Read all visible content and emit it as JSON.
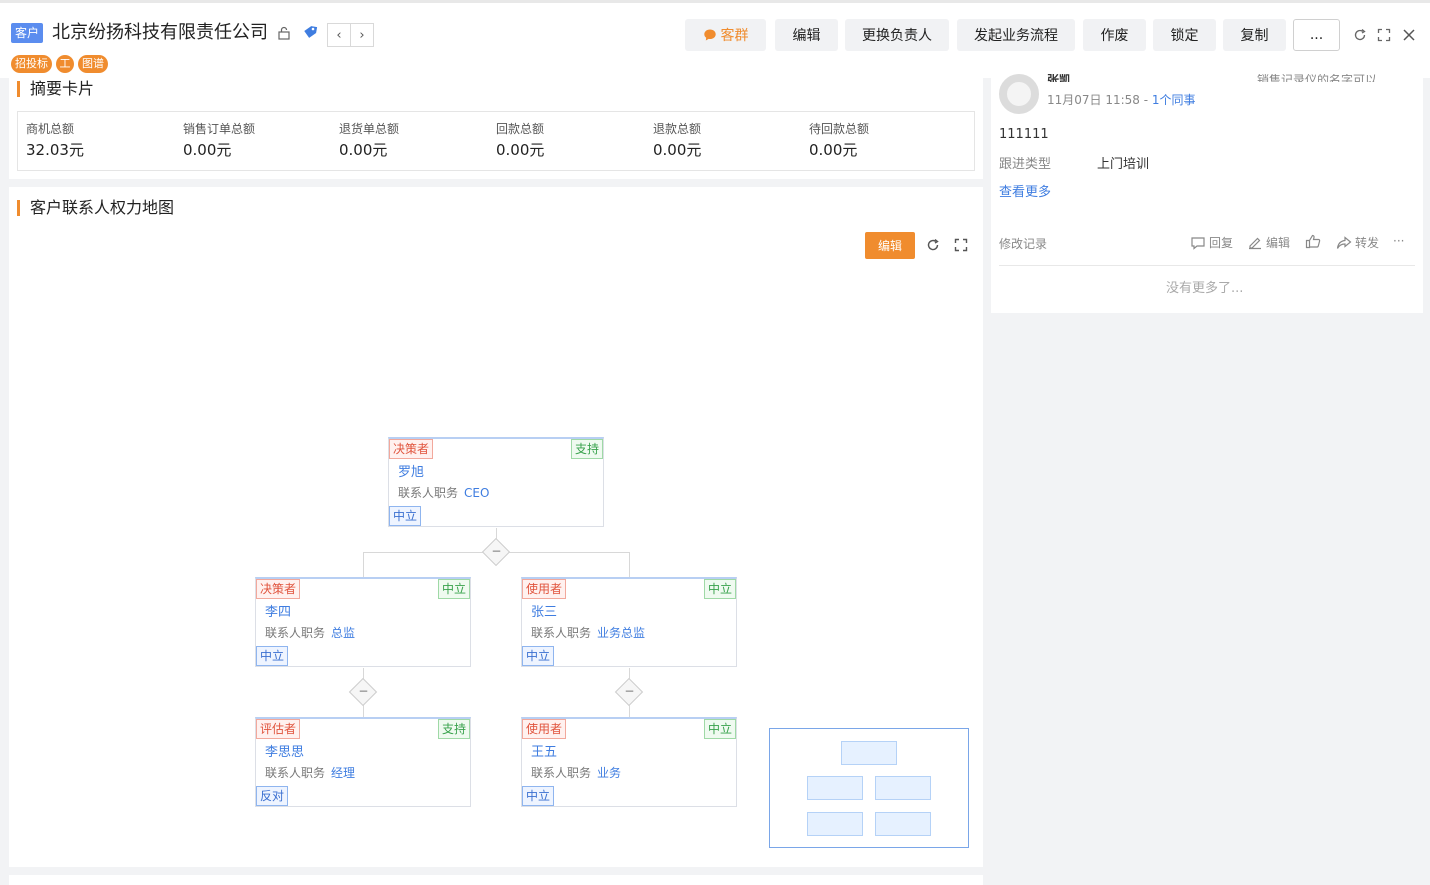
{
  "header": {
    "object_badge": "客户",
    "company_name": "北京纷扬科技有限责任公司",
    "tags": [
      "招投标",
      "工",
      "图谱"
    ],
    "buttons": {
      "group_chat": "客群",
      "edit": "编辑",
      "change_owner": "更换负责人",
      "start_process": "发起业务流程",
      "void": "作废",
      "lock": "锁定",
      "copy": "复制",
      "more": "..."
    }
  },
  "summary": {
    "title": "摘要卡片",
    "items": [
      {
        "label": "商机总额",
        "value": "32.03元"
      },
      {
        "label": "销售订单总额",
        "value": "0.00元"
      },
      {
        "label": "退货单总额",
        "value": "0.00元"
      },
      {
        "label": "回款总额",
        "value": "0.00元"
      },
      {
        "label": "退款总额",
        "value": "0.00元"
      },
      {
        "label": "待回款总额",
        "value": "0.00元"
      }
    ]
  },
  "power_map": {
    "title": "客户联系人权力地图",
    "edit_label": "编辑",
    "post_label": "联系人职务",
    "nodes": [
      {
        "role": "决策者",
        "attitude": "支持",
        "name": "罗旭",
        "post": "CEO",
        "stance": "中立"
      },
      {
        "role": "决策者",
        "attitude": "中立",
        "name": "李四",
        "post": "总监",
        "stance": "中立"
      },
      {
        "role": "使用者",
        "attitude": "中立",
        "name": "张三",
        "post": "业务总监",
        "stance": "中立"
      },
      {
        "role": "评估者",
        "attitude": "支持",
        "name": "李思思",
        "post": "经理",
        "stance": "反对"
      },
      {
        "role": "使用者",
        "attitude": "中立",
        "name": "王五",
        "post": "业务",
        "stance": "中立"
      }
    ]
  },
  "feed": {
    "author": "张凯",
    "header_note": "销售记录仪的名字可以...",
    "time": "11月07日 11:58",
    "separator": " - ",
    "colleagues": "1个同事",
    "content": "111111",
    "follow_type_label": "跟进类型",
    "follow_type_value": "上门培训",
    "see_more": "查看更多",
    "edit_history": "修改记录",
    "actions": {
      "reply": "回复",
      "edit": "编辑",
      "forward": "转发",
      "more": "···"
    },
    "no_more": "没有更多了..."
  },
  "colors": {
    "accent": "#f08c2e",
    "link": "#3f7de0",
    "badge": "#5b8def"
  }
}
